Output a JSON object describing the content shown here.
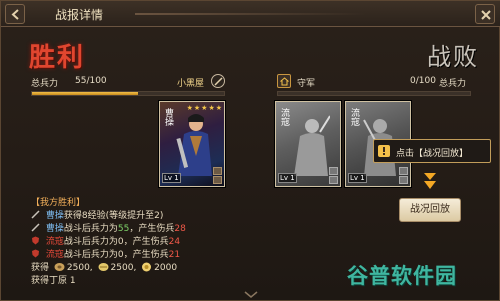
{
  "header": {
    "title": "战报详情"
  },
  "result": {
    "victory_label": "胜利",
    "defeat_label": "战败"
  },
  "attacker": {
    "force_label": "总兵力",
    "force_value": "55/100",
    "force_fraction": 0.55,
    "commander": "小黑屋"
  },
  "defender": {
    "name": "守军",
    "force_value": "0/100",
    "force_label": "总兵力",
    "force_fraction": 0.0
  },
  "cards": [
    {
      "name": "曹操",
      "level": "Lv 1",
      "stars": 5,
      "tone": "color"
    },
    {
      "name": "流寇",
      "level": "Lv 1",
      "stars": 0,
      "tone": "gray"
    },
    {
      "name": "流寇",
      "level": "Lv 1",
      "stars": 0,
      "tone": "gray"
    }
  ],
  "tooltip": {
    "text": "点击【战况回放】"
  },
  "replay_button": {
    "label": "战况回放"
  },
  "log": {
    "title": "【我方胜利】",
    "line1": {
      "name": "曹操",
      "text": "获得8经验(等级提升至2)"
    },
    "line2": {
      "name": "曹操",
      "pre": "战斗后兵力为",
      "troops": "55",
      "mid": "，产生伤兵",
      "wounded": "28"
    },
    "line3": {
      "name": "流寇",
      "pre": "战斗后兵力为",
      "troops": "0",
      "mid": "，产生伤兵",
      "wounded": "24"
    },
    "line4": {
      "name": "流寇",
      "pre": "战斗后兵力为",
      "troops": "0",
      "mid": "，产生伤兵",
      "wounded": "21"
    },
    "rewards_label": "获得",
    "reward1": "2500",
    "reward2": "2500",
    "reward3": "2000",
    "conscript_line": "获得丁原 1"
  },
  "watermark": {
    "text": "谷普软件园"
  },
  "colors": {
    "victory": "#e0462f",
    "gold_bar": "#f3c04a",
    "accent_blue": "#7fbdf2",
    "accent_red": "#e84a3a",
    "watermark": "#3fb6a0"
  }
}
